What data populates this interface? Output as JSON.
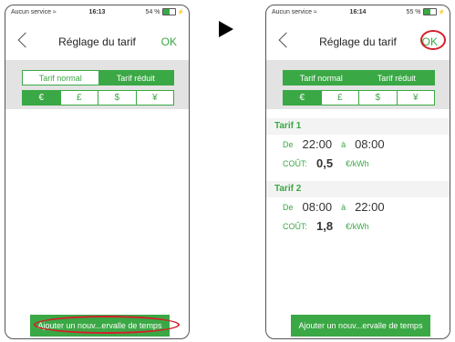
{
  "left_phone": {
    "status": {
      "carrier": "Aucun service",
      "time": "16:13",
      "battery": "54 %"
    },
    "nav": {
      "title": "Réglage du tarif",
      "ok": "OK"
    },
    "tabs": [
      {
        "label": "Tarif normal",
        "active": false
      },
      {
        "label": "Tarif réduit",
        "active": true
      }
    ],
    "currencies": [
      "€",
      "£",
      "$",
      "¥"
    ],
    "add_button": "Ajouter un nouv...ervalle de temps"
  },
  "right_phone": {
    "status": {
      "carrier": "Aucun service",
      "time": "16:14",
      "battery": "55 %"
    },
    "nav": {
      "title": "Réglage du tarif",
      "ok": "OK"
    },
    "tabs": [
      {
        "label": "Tarif normal",
        "active": false
      },
      {
        "label": "Tarif réduit",
        "active": true
      }
    ],
    "currencies": [
      "€",
      "£",
      "$",
      "¥"
    ],
    "tarifs": [
      {
        "title": "Tarif 1",
        "de_label": "De",
        "start": "22:00",
        "a_label": "à",
        "end": "08:00",
        "cout_label": "COÛT:",
        "cost": "0,5",
        "unit": "€/kWh"
      },
      {
        "title": "Tarif 2",
        "de_label": "De",
        "start": "08:00",
        "a_label": "à",
        "end": "22:00",
        "cout_label": "COÛT:",
        "cost": "1,8",
        "unit": "€/kWh"
      }
    ],
    "add_button": "Ajouter un nouv...ervalle de temps"
  },
  "colors": {
    "accent": "#3aa845",
    "highlight": "#d4202b"
  }
}
